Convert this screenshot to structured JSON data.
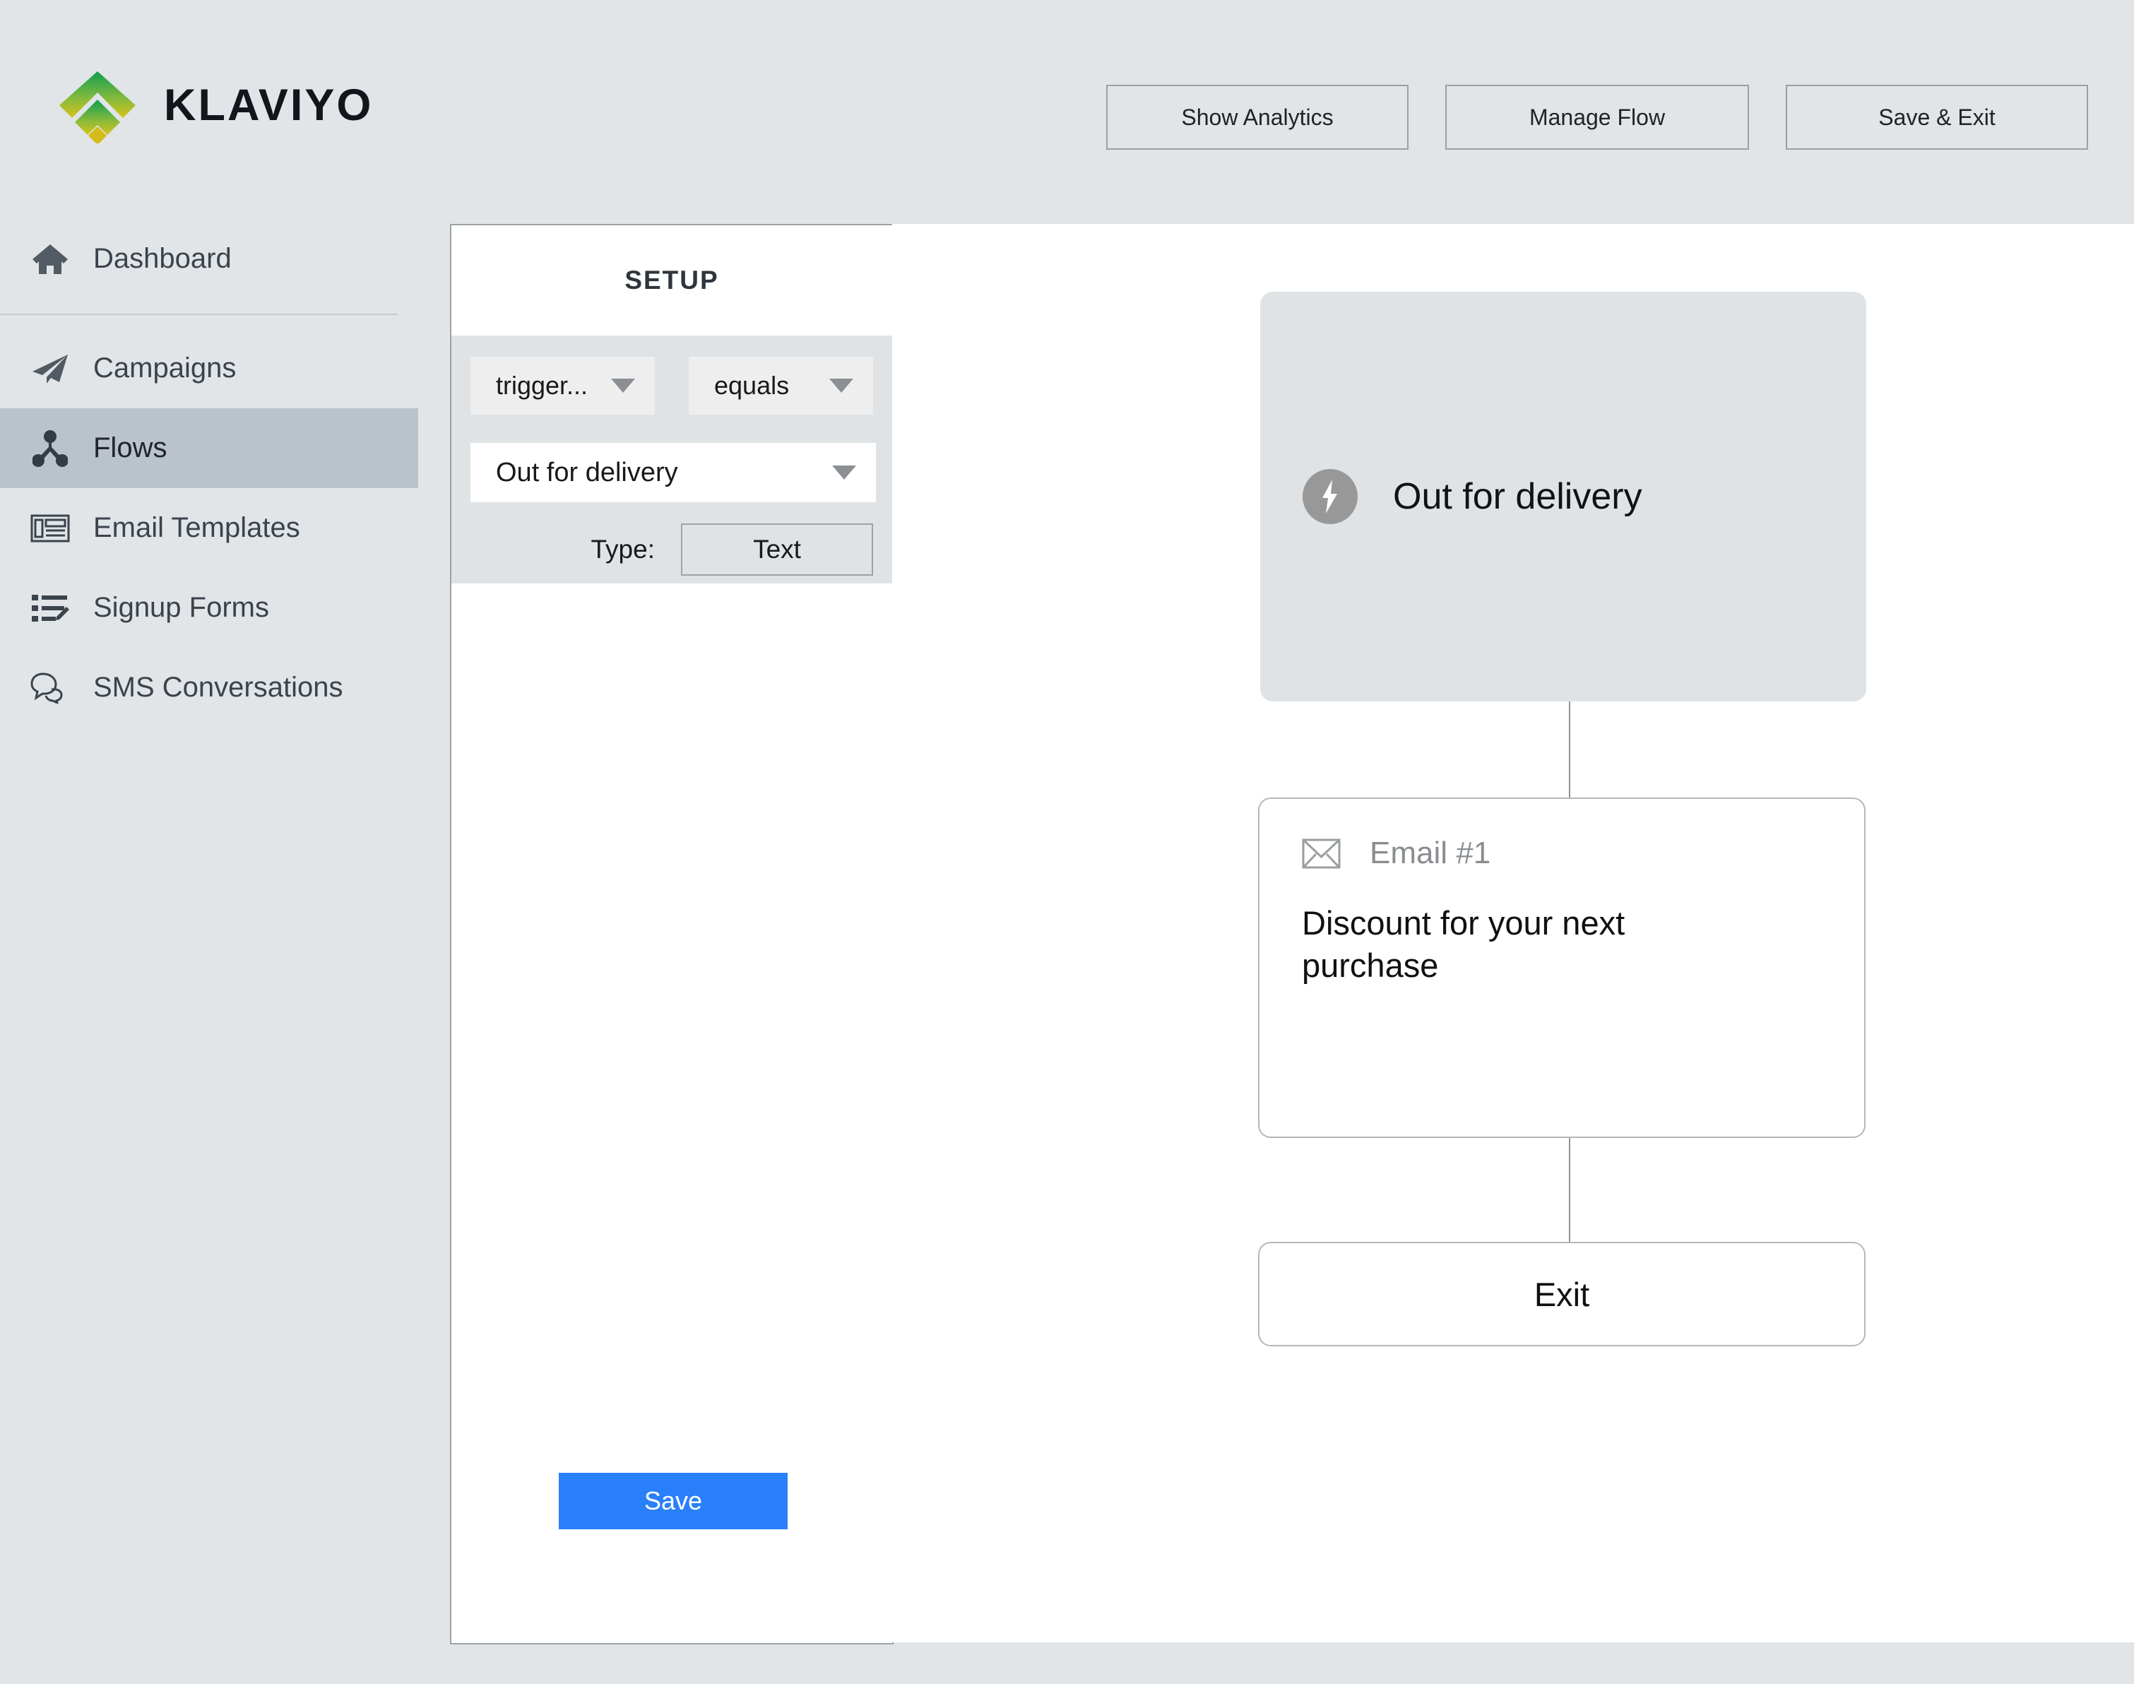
{
  "header": {
    "logo_text": "KLAVIYO",
    "logo_icon": "klaviyo-wifi-chevron-logo",
    "buttons": [
      {
        "label": "Show Analytics",
        "name": "show-analytics-button"
      },
      {
        "label": "Manage Flow",
        "name": "manage-flow-button"
      },
      {
        "label": "Save & Exit",
        "name": "save-and-exit-button"
      }
    ]
  },
  "sidebar": {
    "items": [
      {
        "label": "Dashboard",
        "icon": "home-icon",
        "active": false
      },
      {
        "label": "Campaigns",
        "icon": "paper-plane-icon",
        "active": false
      },
      {
        "label": "Flows",
        "icon": "flow-nodes-icon",
        "active": true
      },
      {
        "label": "Email Templates",
        "icon": "newspaper-icon",
        "active": false
      },
      {
        "label": "Signup Forms",
        "icon": "list-edit-icon",
        "active": false
      },
      {
        "label": "SMS Conversations",
        "icon": "chat-bubbles-icon",
        "active": false
      }
    ]
  },
  "setup": {
    "title": "SETUP",
    "trigger_select": {
      "value": "trigger...",
      "caret_icon": "chevron-down-icon"
    },
    "operator_select": {
      "value": "equals",
      "caret_icon": "chevron-down-icon"
    },
    "value_select": {
      "value": "Out for delivery",
      "caret_icon": "chevron-down-icon"
    },
    "type_label": "Type:",
    "type_value": "Text",
    "delete_icon": "trash-icon",
    "save_label": "Save"
  },
  "flow": {
    "trigger": {
      "icon": "lightning-bolt-icon",
      "label": "Out for delivery"
    },
    "email": {
      "icon": "envelope-icon",
      "title": "Email #1",
      "subject": "Discount for your next purchase"
    },
    "exit": {
      "label": "Exit"
    }
  },
  "colors": {
    "background": "#e1e5e7",
    "panel_form": "#dfe3e5",
    "save_blue": "#2a7ffa",
    "active_nav": "#bac2ca",
    "border_gray": "#9ca2a6",
    "logo_green": "#16a34a",
    "logo_yellow": "#d4bb1a"
  }
}
